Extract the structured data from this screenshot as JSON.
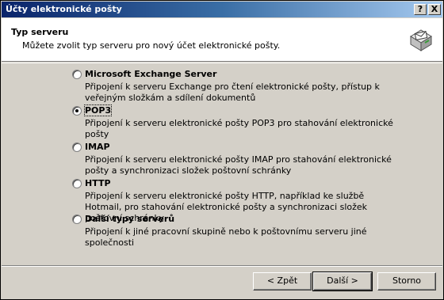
{
  "window": {
    "title": "Účty elektronické pošty"
  },
  "titlebar": {
    "help_label": "?",
    "close_label": "X"
  },
  "header": {
    "title": "Typ serveru",
    "subtitle": "Můžete zvolit typ serveru pro nový účet elektronické pošty."
  },
  "options": [
    {
      "label": "Microsoft Exchange Server",
      "selected": false,
      "desc": "Připojení k serveru Exchange pro čtení elektronické pošty, přístup k veřejným složkám a sdílení dokumentů"
    },
    {
      "label": "POP3",
      "selected": true,
      "desc": "Připojení k serveru elektronické pošty POP3 pro stahování elektronické pošty"
    },
    {
      "label": "IMAP",
      "selected": false,
      "desc": "Připojení k serveru elektronické pošty IMAP pro stahování elektronické pošty a synchronizaci složek poštovní schránky"
    },
    {
      "label": "HTTP",
      "selected": false,
      "desc": "Připojení k serveru elektronické pošty HTTP, například ke službě Hotmail, pro stahování elektronické pošty a synchronizaci složek poštovní schránky"
    },
    {
      "label": "Další typy serverů",
      "selected": false,
      "desc": "Připojení k jiné pracovní skupině nebo k poštovnímu serveru jiné společnosti"
    }
  ],
  "buttons": {
    "back": "< Zpět",
    "next": "Další >",
    "cancel": "Storno"
  },
  "icons": {
    "header": "mail-server-icon"
  }
}
